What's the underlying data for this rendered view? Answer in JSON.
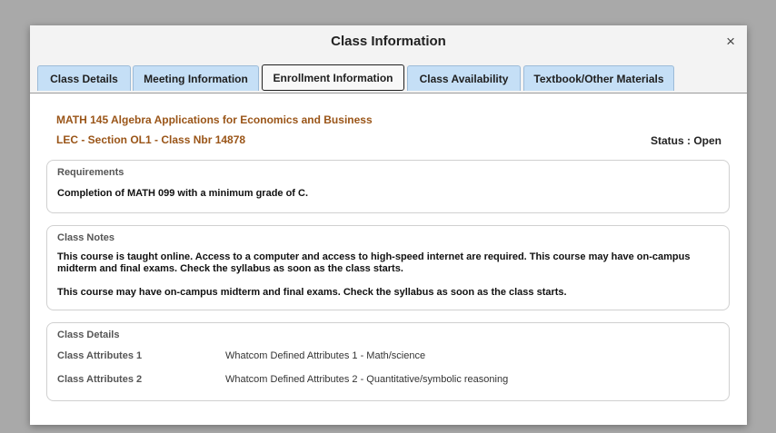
{
  "modal": {
    "title": "Class Information",
    "close_glyph": "×"
  },
  "tabs": [
    {
      "label": "Class Details",
      "active": false
    },
    {
      "label": "Meeting Information",
      "active": false
    },
    {
      "label": "Enrollment Information",
      "active": true
    },
    {
      "label": "Class Availability",
      "active": false
    },
    {
      "label": "Textbook/Other Materials",
      "active": false
    }
  ],
  "course": {
    "title": "MATH 145 Algebra Applications for Economics and Business",
    "section": "LEC - Section OL1 - Class Nbr 14878",
    "status": "Status : Open"
  },
  "requirements": {
    "title": "Requirements",
    "text": "Completion of MATH 099 with a minimum grade of C."
  },
  "class_notes": {
    "title": "Class Notes",
    "note1": "This course is taught online.  Access to a computer and access to high-speed internet are required. This course may have on-campus midterm and final exams. Check the syllabus as soon as the class starts.",
    "note2": "This course may have on-campus midterm and final exams.  Check the syllabus as soon as the class starts."
  },
  "class_details": {
    "title": "Class Details",
    "attributes": [
      {
        "label": "Class Attributes 1",
        "value": "Whatcom Defined Attributes 1 - Math/science"
      },
      {
        "label": "Class Attributes 2",
        "value": "Whatcom Defined Attributes 2 - Quantitative/symbolic reasoning"
      }
    ]
  },
  "colors": {
    "tab_bg": "#c5dff6",
    "course_text": "#9a5518",
    "overlay": "#a9a9a9"
  }
}
